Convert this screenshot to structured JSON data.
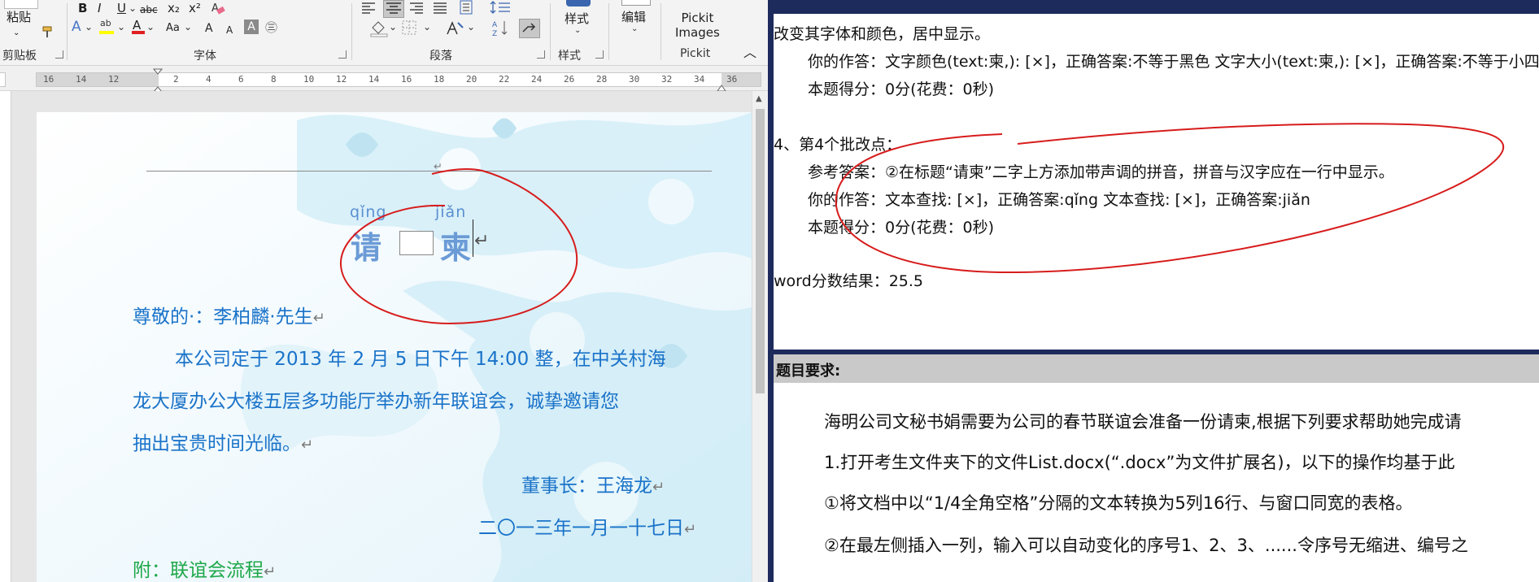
{
  "ribbon": {
    "paste_label": "粘贴",
    "clipboard_group": "剪贴板",
    "font_group": "字体",
    "paragraph_group": "段落",
    "styles_group": "样式",
    "styles_label": "样式",
    "edit_label": "编辑",
    "pickit_label_1": "Pickit",
    "pickit_label_2": "Images",
    "pickit_group": "Pickit",
    "bold": "B",
    "italic": "I",
    "underline": "U",
    "strike": "abc",
    "subscript": "x₂",
    "superscript": "x²",
    "font_case": "Aa",
    "grow_font": "A",
    "shrink_font": "A",
    "char_border": "A",
    "enclose": "㊂",
    "font_color_letter": "A",
    "text_effect_letter": "A",
    "highlight_letter": "ab"
  },
  "ruler": {
    "labels": [
      "16",
      "14",
      "12",
      "",
      "2",
      "4",
      "6",
      "8",
      "10",
      "12",
      "14",
      "16",
      "18",
      "20",
      "22",
      "24",
      "26",
      "28",
      "30",
      "32",
      "34",
      "36"
    ]
  },
  "document": {
    "pinyin_1": "qǐng",
    "pinyin_2": "jiǎn",
    "title_char_1": "请",
    "title_char_2": "柬",
    "salutation": "尊敬的·：李柏麟·先生",
    "body_line_1": "本公司定于 2013 年 2 月 5 日下午 14:00 整，在中关村海",
    "body_line_2": "龙大厦办公大楼五层多功能厅举办新年联谊会，诚挚邀请您",
    "body_line_3": "抽出宝贵时间光临。",
    "signature": "董事长：王海龙",
    "date": "二〇一三年一月一十七日",
    "attachment": "附：联谊会流程",
    "para_mark": "↵",
    "colors": {
      "text_blue": "#1a73c9",
      "green": "#1ea84a"
    }
  },
  "result": {
    "line_1": "改变其字体和颜色，居中显示。",
    "line_2": "你的作答：文字颜色(text:柬,): [×]，正确答案:不等于黑色  文字大小(text:柬,): [×]，正确答案:不等于小四",
    "line_3": "本题得分：0分(花费：0秒)",
    "item_4": "4、第4个批改点：",
    "ref_answer": "参考答案：②在标题“请柬”二字上方添加带声调的拼音，拼音与汉字应在一行中显示。",
    "your_answer": "你的作答：文本查找: [×]，正确答案:qǐng  文本查找: [×]，正确答案:jiǎn",
    "score": "本题得分：0分(花费：0秒)",
    "word_score": "word分数结果：25.5"
  },
  "requirements": {
    "title": "题目要求:",
    "p1": "海明公司文秘书娟需要为公司的春节联谊会准备一份请柬,根据下列要求帮助她完成请",
    "p2": "1.打开考生文件夹下的文件List.docx(“.docx”为文件扩展名)，以下的操作均基于此",
    "p3": "①将文档中以“1/4全角空格”分隔的文本转换为5列16行、与窗口同宽的表格。",
    "p4": "②在最左侧插入一列，输入可以自动变化的序号1、2、3、......令序号无缩进、编号之"
  }
}
